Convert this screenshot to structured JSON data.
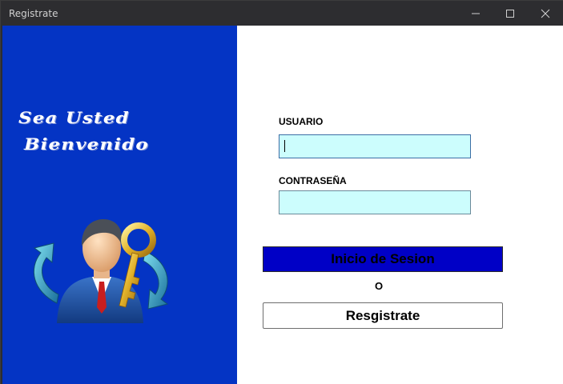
{
  "window": {
    "title": "Registrate"
  },
  "welcome": {
    "line1": "Sea Usted",
    "line2": "Bienvenido"
  },
  "form": {
    "user_label": "USUARIO",
    "user_value": "",
    "password_label": "CONTRASEÑA",
    "password_value": "",
    "login_label": "Inicio de Sesion",
    "or_label": "O",
    "register_label": "Resgistrate"
  },
  "icons": {
    "minimize": "minimize-icon",
    "maximize": "maximize-icon",
    "close": "close-icon",
    "illustration": "user-key-icon"
  },
  "colors": {
    "left_panel": "#0434c4",
    "input_bg": "#ccfdfd",
    "login_button": "#0000c6",
    "titlebar": "#2d2d30"
  }
}
